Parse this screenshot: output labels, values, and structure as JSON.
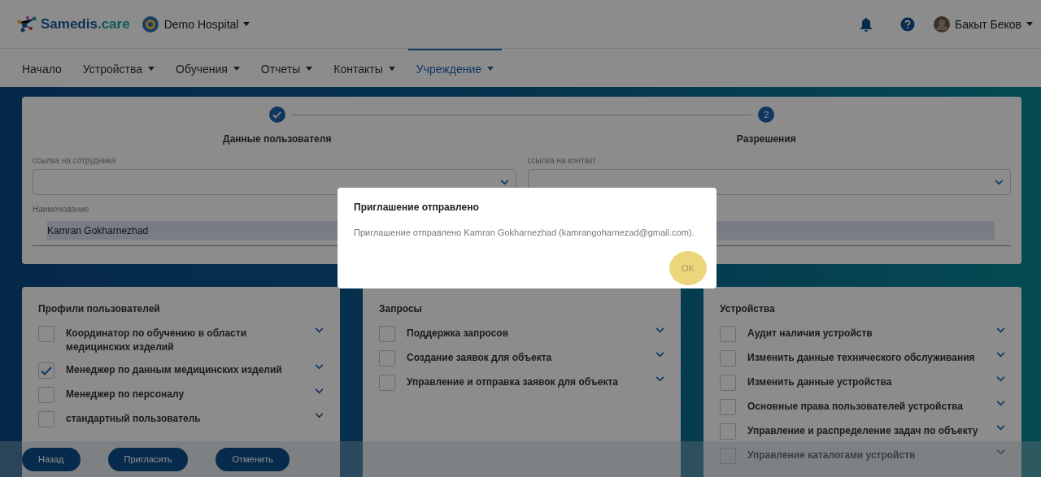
{
  "header": {
    "logo": "Samedis",
    "logo_suffix": ".care",
    "hospital": "Demo Hospital",
    "user": "Бакыт Беков"
  },
  "nav": [
    {
      "label": "Начало",
      "dropdown": false,
      "selected": false
    },
    {
      "label": "Устройства",
      "dropdown": true,
      "selected": false
    },
    {
      "label": "Обучения",
      "dropdown": true,
      "selected": false
    },
    {
      "label": "Отчеты",
      "dropdown": true,
      "selected": false
    },
    {
      "label": "Контакты",
      "dropdown": true,
      "selected": false
    },
    {
      "label": "Учреждение",
      "dropdown": true,
      "selected": true
    }
  ],
  "stepper": [
    {
      "label": "Данные пользователя",
      "done": true
    },
    {
      "label": "Разрешения",
      "number": "2",
      "done": false
    }
  ],
  "form": {
    "fields": [
      {
        "kind": "select",
        "label": "ссылка на сотрудника"
      },
      {
        "kind": "select",
        "label": "ссылка на контакт"
      },
      {
        "kind": "text",
        "label": "Наименование",
        "value": "Kamran Gokharnezhad"
      },
      {
        "kind": "text"
      }
    ]
  },
  "panels": [
    {
      "title": "Профили пользователей",
      "items": [
        {
          "label": "Координатор по обучению в области медицинских изделий",
          "checked": false
        },
        {
          "label": "Менеджер по данным медицинских изделий",
          "checked": true
        },
        {
          "label": "Менеджер по персоналу",
          "checked": false
        },
        {
          "label": "стандартный пользователь",
          "checked": false
        }
      ]
    },
    {
      "title": "Запросы",
      "items": [
        {
          "label": "Поддержка запросов",
          "checked": false
        },
        {
          "label": "Создание заявок для объекта",
          "checked": false
        },
        {
          "label": "Управление и отправка заявок для объекта",
          "checked": false
        }
      ]
    },
    {
      "title": "Устройства",
      "items": [
        {
          "label": "Аудит наличия устройств",
          "checked": false
        },
        {
          "label": "Изменить данные технического обслуживания",
          "checked": false
        },
        {
          "label": "Изменить данные устройства",
          "checked": false
        },
        {
          "label": "Основные права пользователей устройства",
          "checked": false
        },
        {
          "label": "Управление и распределение задач по объекту",
          "checked": false
        },
        {
          "label": "Управление каталогами устройств",
          "checked": false
        }
      ]
    }
  ],
  "actions": [
    "Назад",
    "Пригласить",
    "Отменить"
  ],
  "dialog": {
    "title": "Приглашение отправлено",
    "message": "Приглашение отправлено Kamran Gokharnezhad (kamrangoharnezad@gmail.com).",
    "ok": "OK"
  }
}
